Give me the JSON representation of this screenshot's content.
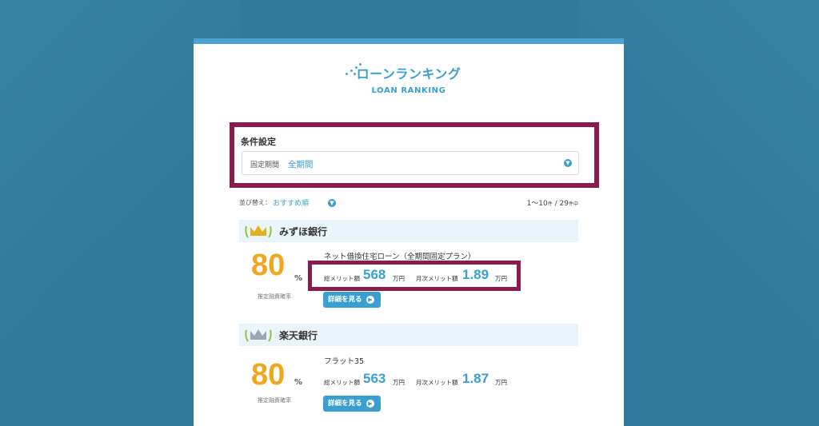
{
  "header": {
    "title_ja": "ローンランキング",
    "title_en": "LOAN RANKING"
  },
  "filter": {
    "title": "条件設定",
    "label": "固定期間",
    "value": "全期間",
    "dropdown_icon": "chevron-down-icon"
  },
  "sort": {
    "label": "並び替え：",
    "value": "おすすめ順",
    "dropdown_icon": "chevron-down-icon",
    "range": "1〜10",
    "range_unit": "件",
    "separator": " / ",
    "total": "29",
    "total_unit": "件中"
  },
  "banks": [
    {
      "rank_icon": "gold-crown-icon",
      "name": "みずほ銀行",
      "rate": "80",
      "rate_unit": "%",
      "rate_label": "推定融資確率",
      "plan": "ネット借換住宅ローン（全期間固定プラン）",
      "total_label": "総メリット額",
      "total_value": "568",
      "total_unit": "万円",
      "monthly_label": "月次メリット額",
      "monthly_value": "1.89",
      "monthly_unit": "万円",
      "button": "詳細を見る"
    },
    {
      "rank_icon": "silver-crown-icon",
      "name": "楽天銀行",
      "rate": "80",
      "rate_unit": "%",
      "rate_label": "推定融資確率",
      "plan": "フラット35",
      "total_label": "総メリット額",
      "total_value": "563",
      "total_unit": "万円",
      "monthly_label": "月次メリット額",
      "monthly_value": "1.87",
      "monthly_unit": "万円",
      "button": "詳細を見る"
    }
  ],
  "colors": {
    "background": "#2e7a9b",
    "accent": "#3a9fd0",
    "highlight_border": "#8b1a4e",
    "rate": "#f0a71e"
  }
}
